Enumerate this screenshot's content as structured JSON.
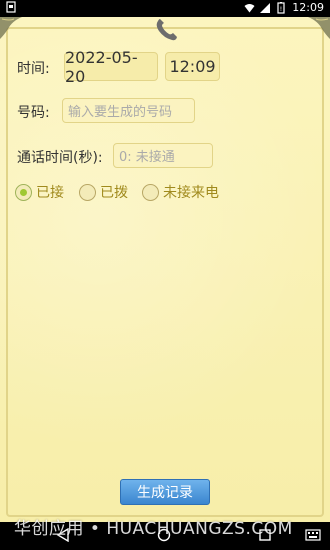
{
  "status_bar": {
    "time": "12:09"
  },
  "form": {
    "time_label": "时间:",
    "date_value": "2022-05-20",
    "time_value": "12:09",
    "number_label": "号码:",
    "number_placeholder": "输入要生成的号码",
    "duration_label": "通话时间(秒):",
    "duration_placeholder": "0: 未接通"
  },
  "call_type": {
    "options": [
      {
        "label": "已接",
        "checked": true
      },
      {
        "label": "已拨",
        "checked": false
      },
      {
        "label": "未接来电",
        "checked": false
      }
    ]
  },
  "actions": {
    "generate_label": "生成记录"
  },
  "watermark": "华创应用 • HUACHUANGZS.COM",
  "colors": {
    "paper": "#fbf3b8",
    "radio_text": "#a08a1d",
    "radio_checked": "#9fc832",
    "button": "#3b86cf"
  }
}
